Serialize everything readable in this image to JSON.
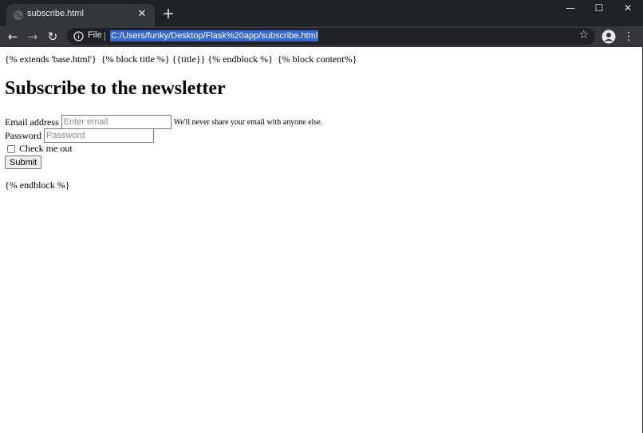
{
  "browser": {
    "tab_title": "subscribe.html",
    "tab_close": "✕",
    "new_tab": "+",
    "window_buttons": {
      "minimize": "—",
      "maximize": "☐",
      "close": "✕"
    },
    "nav": {
      "back": "←",
      "forward": "→",
      "reload": "↻"
    },
    "site_label": "File",
    "url": "C:/Users/funky/Desktop/Flask%20app/subscribe.html",
    "star": "☆",
    "menu": "⋮",
    "colors": {
      "frame": "#202124",
      "toolbar": "#35363a",
      "url_highlight": "#3367d6"
    }
  },
  "page": {
    "template_header": "{% extends 'base.html'}  {% block title %} {{title}} {% endblock %}  {% block content%}",
    "heading": "Subscribe to the newsletter",
    "email_label": "Email address",
    "email_placeholder": "Enter email",
    "email_help": "We'll never share your email with anyone else.",
    "password_label": "Password",
    "password_placeholder": "Password",
    "checkbox_label": "Check me out",
    "checkbox_checked": false,
    "submit_label": "Submit",
    "template_footer": "{% endblock %}"
  }
}
